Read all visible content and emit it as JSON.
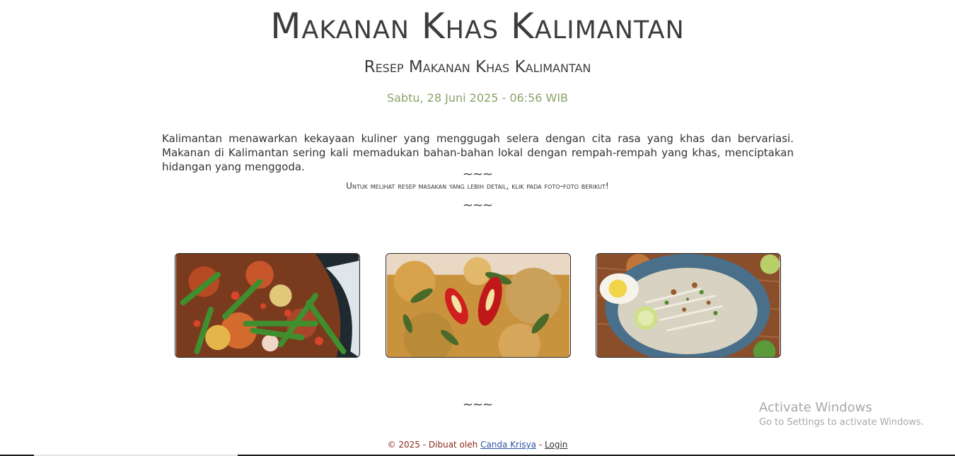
{
  "header": {
    "title": "Makanan Khas Kalimantan",
    "subtitle": "Resep Makanan Khas Kalimantan",
    "datetime": "Sabtu, 28 Juni 2025 - 06:56 WIB"
  },
  "intro": {
    "text": "Kalimantan menawarkan kekayaan kuliner yang menggugah selera dengan cita rasa yang khas dan bervariasi. Makanan di Kalimantan sering kali memadukan bahan-bahan lokal dengan rempah-rempah yang khas, menciptakan hidangan yang menggoda."
  },
  "divider": {
    "symbol": "~~~"
  },
  "hint": {
    "text": "Untuk melihat resep masakan yang lebih detail, klik pada foto-foto berikut!"
  },
  "gallery": {
    "photos": [
      {
        "icon": "food-photo-icon",
        "colors": {
          "base": "#7a3a1e",
          "accent": "#3f8f2e",
          "highlight": "#d8452a"
        }
      },
      {
        "icon": "food-photo-icon",
        "colors": {
          "base": "#c9933e",
          "accent": "#4a6a2a",
          "highlight": "#d11e1e"
        }
      },
      {
        "icon": "food-photo-icon",
        "colors": {
          "base": "#4a6f8a",
          "accent": "#e8e0cf",
          "highlight": "#f2d44a"
        }
      }
    ]
  },
  "footer": {
    "prefix": "© 2025 - Dibuat oleh",
    "author_link": "Canda Krisya",
    "separator": "-",
    "login_link": "Login"
  },
  "watermark": {
    "title": "Activate Windows",
    "subtitle": "Go to Settings to activate Windows."
  }
}
